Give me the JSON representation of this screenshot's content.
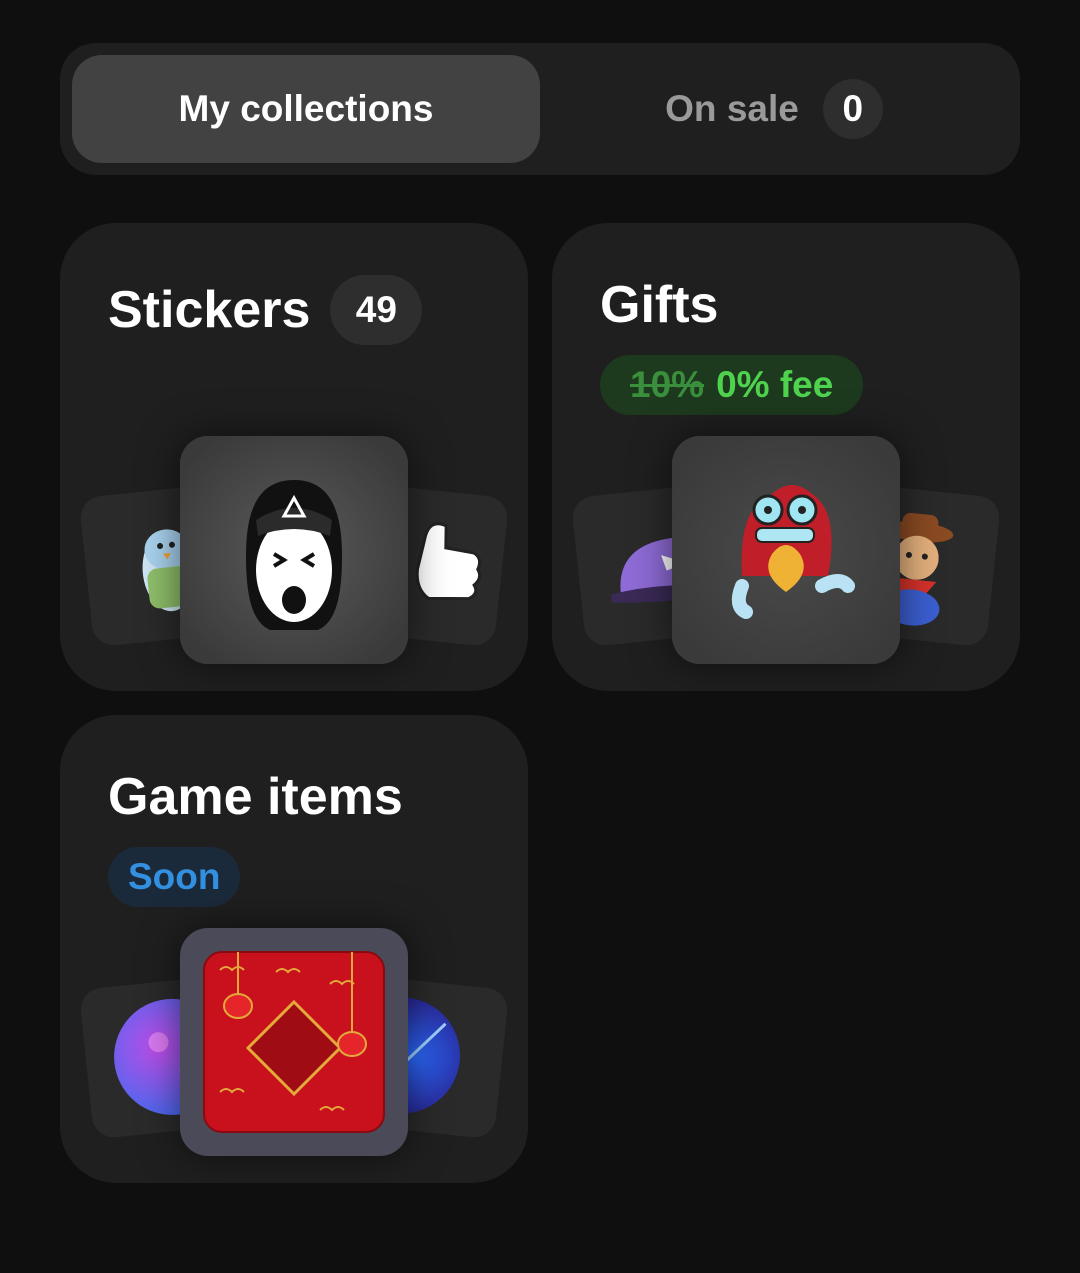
{
  "tabs": {
    "my_collections": "My collections",
    "on_sale": "On sale",
    "on_sale_count": "0"
  },
  "cards": {
    "stickers": {
      "title": "Stickers",
      "count": "49"
    },
    "gifts": {
      "title": "Gifts",
      "fee_old": "10%",
      "fee_new": "0% fee"
    },
    "game_items": {
      "title": "Game items",
      "badge": "Soon"
    }
  },
  "colors": {
    "background": "#0f0f0f",
    "card": "#1f1f1f",
    "active_tab": "#424242",
    "fee_green": "#4fd34f",
    "soon_blue": "#3390e0"
  }
}
